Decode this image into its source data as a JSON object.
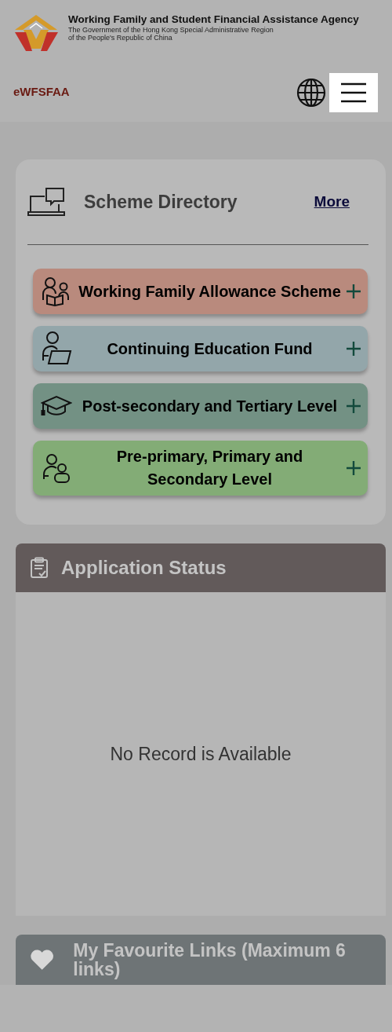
{
  "header": {
    "agency_name": "Working Family and Student Financial Assistance Agency",
    "government_line_1": "The Government of the Hong Kong Special Administrative Region",
    "government_line_2": "of the People's Republic of China",
    "site_name": "eWFSFAA",
    "menu_button": {
      "highlighted": true
    }
  },
  "scheme_directory": {
    "title": "Scheme Directory",
    "more_link": "More",
    "schemes": [
      {
        "label": "Working Family Allowance Scheme",
        "kind": "family",
        "color": "#b98a7d"
      },
      {
        "label": "Continuing Education Fund",
        "kind": "learner",
        "color": "#93a6aa"
      },
      {
        "label": "Post-secondary and Tertiary Level",
        "kind": "graduate",
        "color": "#739184"
      },
      {
        "label": "Pre-primary, Primary and Secondary Level",
        "kind": "students",
        "color": "#83ac76"
      }
    ]
  },
  "application_status": {
    "title": "Application Status",
    "message": "No Record is Available"
  },
  "favourite_links": {
    "title": "My Favourite Links (Maximum 6 links)"
  }
}
